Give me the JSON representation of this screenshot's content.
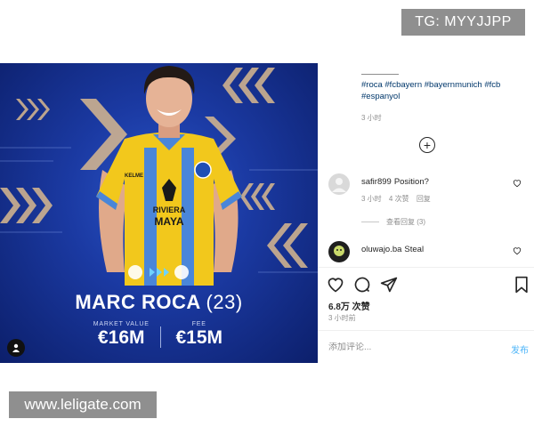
{
  "watermarks": {
    "top": "TG: MYYJJPP",
    "bottom": "www.leligate.com"
  },
  "post_image": {
    "sponsor_text": "RIVIERA MAYA",
    "kit_brand": "KELME",
    "player_name": "MARC ROCA",
    "player_age": "(23)",
    "market_value_label": "MARKET VALUE",
    "market_value": "€16M",
    "fee_label": "FEE",
    "fee": "€15M",
    "colors": {
      "bg_dark": "#0c1f6b",
      "bg_light": "#2a55c7",
      "shirt": "#f2c81c",
      "chevron": "#d9b98f"
    }
  },
  "caption": {
    "hashtags": "#roca #fcbayern #bayernmunich #fcb #espanyol",
    "time": "3 小时"
  },
  "comments": [
    {
      "user": "safir899",
      "text": "Position?",
      "time": "3 小时",
      "likes": "4 次赞",
      "reply": "回复",
      "view_replies": "查看回复 (3)"
    },
    {
      "user": "oluwajo.ba",
      "text": "Steal"
    }
  ],
  "likes": "6.8万 次赞",
  "post_time": "3 小时前",
  "comment_box": {
    "placeholder": "添加评论...",
    "post_label": "发布"
  },
  "icons": [
    "plus-circle-icon",
    "heart-icon",
    "comment-icon",
    "share-icon",
    "bookmark-icon"
  ]
}
